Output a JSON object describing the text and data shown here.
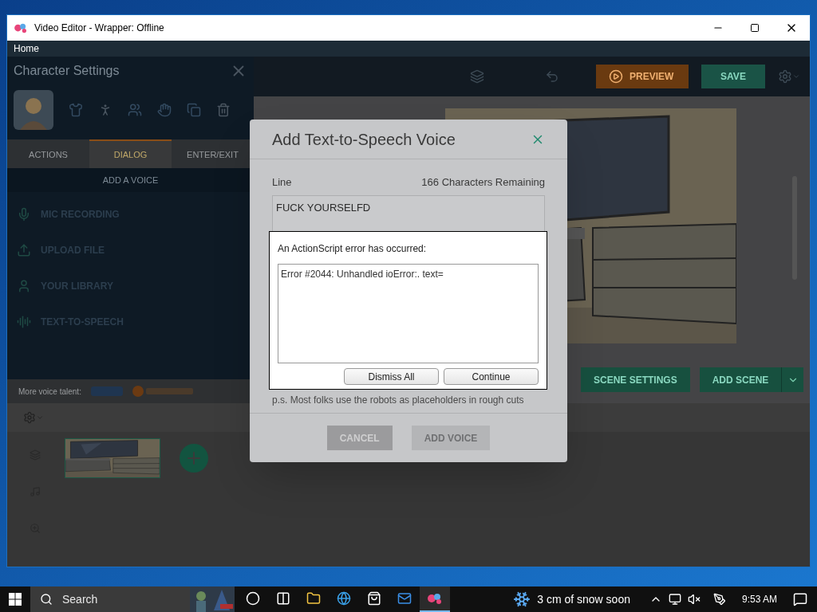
{
  "window": {
    "title": "Video Editor - Wrapper: Offline"
  },
  "menu": [
    {
      "label": "Home"
    }
  ],
  "character_panel": {
    "title": "Character Settings",
    "tabs": [
      {
        "label": "ACTIONS",
        "selected": false
      },
      {
        "label": "DIALOG",
        "selected": true
      },
      {
        "label": "ENTER/EXIT",
        "selected": false
      }
    ],
    "section": "ADD A VOICE",
    "options": [
      {
        "label": "MIC RECORDING",
        "kind": "mic"
      },
      {
        "label": "UPLOAD FILE",
        "kind": "upload"
      },
      {
        "label": "YOUR LIBRARY",
        "kind": "library"
      },
      {
        "label": "TEXT-TO-SPEECH",
        "kind": "tts"
      }
    ],
    "talent_label": "More voice talent:"
  },
  "toolbar": {
    "buttons": [
      {
        "label": "PREVIEW",
        "kind": "preview"
      },
      {
        "label": "SAVE",
        "kind": "save"
      }
    ]
  },
  "stage": {
    "buttons": [
      {
        "label": "SCENE SETTINGS"
      },
      {
        "label": "ADD SCENE"
      }
    ]
  },
  "dialog": {
    "title": "Add Text-to-Speech Voice",
    "line_label": "Line",
    "remaining": "166 Characters Remaining",
    "line_value": "FUCK YOURSELFD",
    "note": "p.s. Most folks use the robots as placeholders in rough cuts",
    "buttons": [
      {
        "label": "CANCEL",
        "disabled": false
      },
      {
        "label": "ADD VOICE",
        "disabled": true
      }
    ]
  },
  "error": {
    "title": "An ActionScript error has occurred:",
    "message": "Error #2044: Unhandled ioError:. text=",
    "buttons": [
      {
        "label": "Dismiss All"
      },
      {
        "label": "Continue"
      }
    ]
  },
  "taskbar": {
    "search_placeholder": "Search",
    "apps": [
      {
        "kind": "cortana",
        "selected": false
      },
      {
        "kind": "taskview",
        "selected": false
      },
      {
        "kind": "explorer",
        "selected": false
      },
      {
        "kind": "edge",
        "selected": false
      },
      {
        "kind": "store",
        "selected": false
      },
      {
        "kind": "mail",
        "selected": false
      },
      {
        "kind": "wrapper",
        "selected": true
      }
    ],
    "weather": "3 cm of snow soon",
    "time": "9:53 AM"
  }
}
